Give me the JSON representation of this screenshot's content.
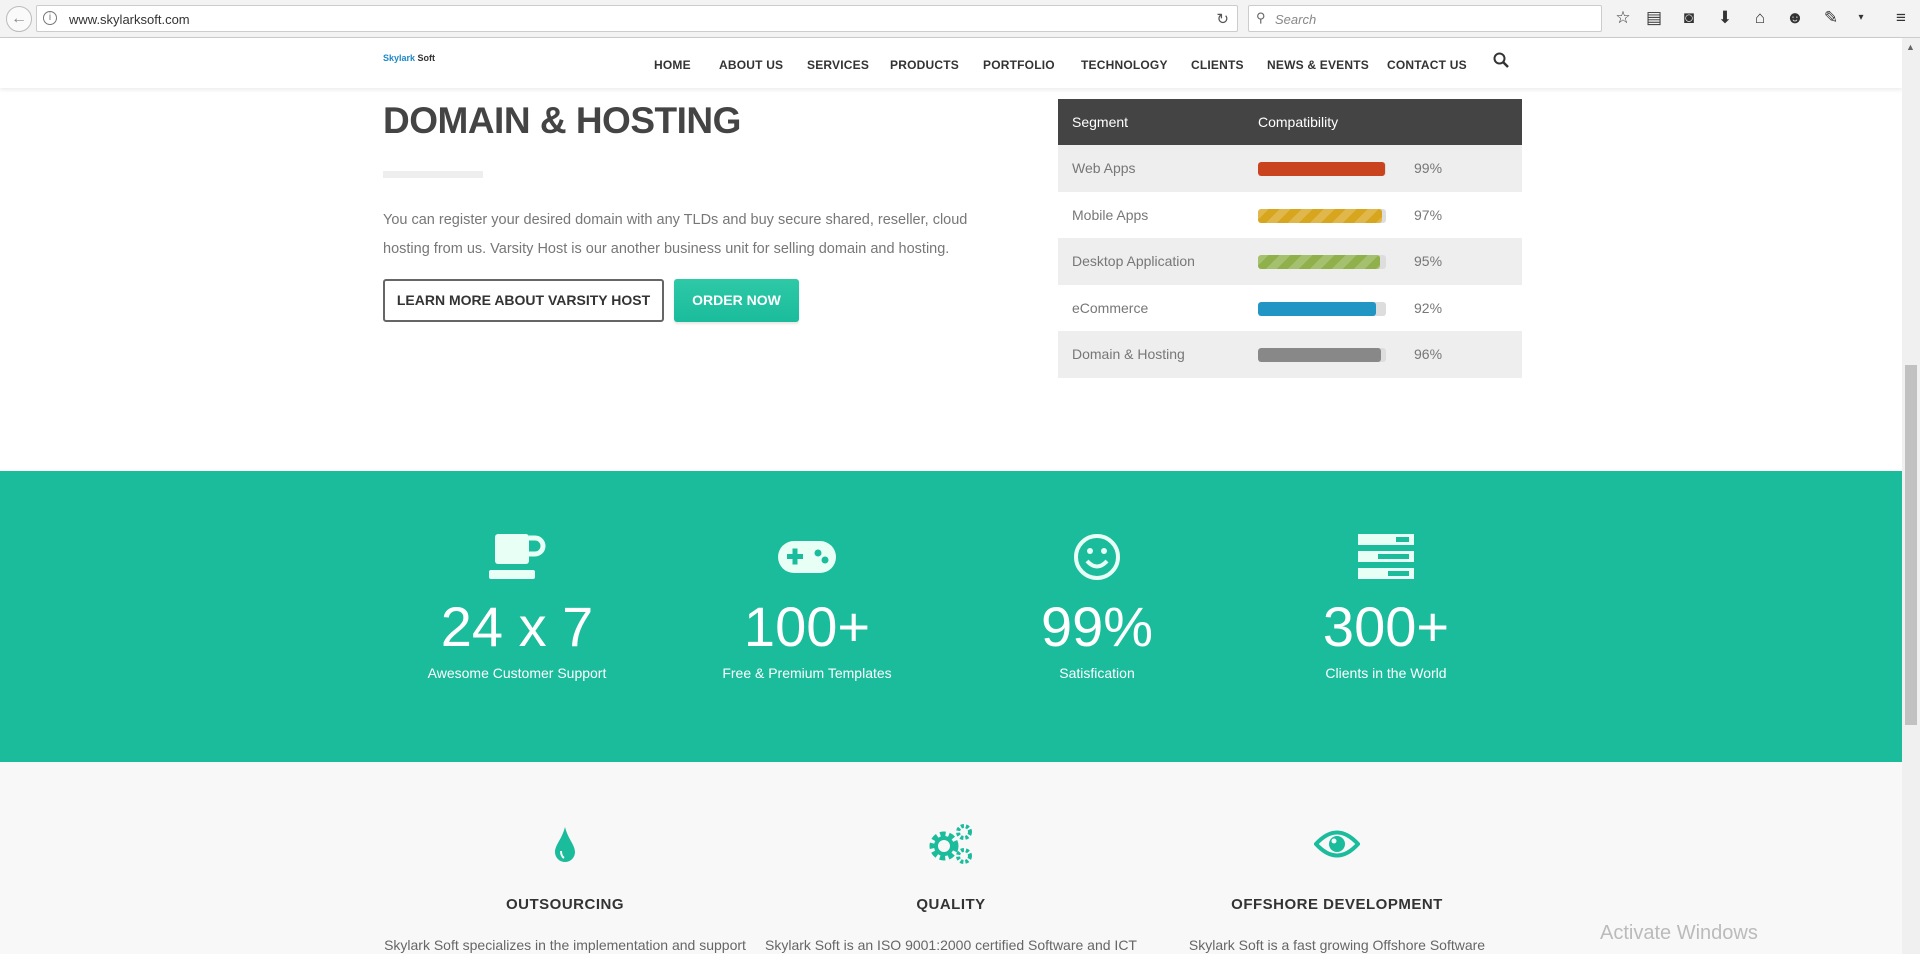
{
  "browser": {
    "url": "www.skylarksoft.com",
    "search_placeholder": "Search"
  },
  "nav": {
    "logo": "Skylark Soft",
    "items": [
      "HOME",
      "ABOUT US",
      "SERVICES",
      "PRODUCTS",
      "PORTFOLIO",
      "TECHNOLOGY",
      "CLIENTS",
      "NEWS & EVENTS",
      "CONTACT US"
    ]
  },
  "hero": {
    "title": "DOMAIN & HOSTING",
    "text": "You can register your desired domain with any TLDs and buy secure shared, reseller, cloud hosting from us. Varsity Host is our another business unit for selling domain and hosting.",
    "learn_more": "LEARN MORE ABOUT VARSITY HOST",
    "order": "ORDER NOW"
  },
  "table": {
    "headers": [
      "Segment",
      "Compatibility"
    ],
    "rows": [
      {
        "segment": "Web Apps",
        "value": 99,
        "label": "99%",
        "color": "#c9431e",
        "striped": false
      },
      {
        "segment": "Mobile Apps",
        "value": 97,
        "label": "97%",
        "color": "#d8a51e",
        "striped": true
      },
      {
        "segment": "Desktop Application",
        "value": 95,
        "label": "95%",
        "color": "#8fb04a",
        "striped": true
      },
      {
        "segment": "eCommerce",
        "value": 92,
        "label": "92%",
        "color": "#2196c4",
        "striped": false
      },
      {
        "segment": "Domain & Hosting",
        "value": 96,
        "label": "96%",
        "color": "#888888",
        "striped": false
      }
    ]
  },
  "stats": [
    {
      "icon": "coffee-cup-icon",
      "number": "24 x 7",
      "label": "Awesome Customer Support"
    },
    {
      "icon": "gamepad-icon",
      "number": "100+",
      "label": "Free & Premium Templates"
    },
    {
      "icon": "smile-icon",
      "number": "99%",
      "label": "Satisfication"
    },
    {
      "icon": "server-icon",
      "number": "300+",
      "label": "Clients in the World"
    }
  ],
  "features": [
    {
      "icon": "drop-icon",
      "title": "OUTSOURCING",
      "text": "Skylark Soft specializes in the implementation and support"
    },
    {
      "icon": "gears-icon",
      "title": "QUALITY",
      "text": "Skylark Soft is an ISO 9001:2000 certified Software and ICT"
    },
    {
      "icon": "eye-icon",
      "title": "OFFSHORE DEVELOPMENT",
      "text": "Skylark Soft is a fast growing Offshore Software"
    }
  ],
  "watermark": "Activate Windows",
  "colors": {
    "accent": "#1abc9c",
    "table_header": "#444444"
  }
}
